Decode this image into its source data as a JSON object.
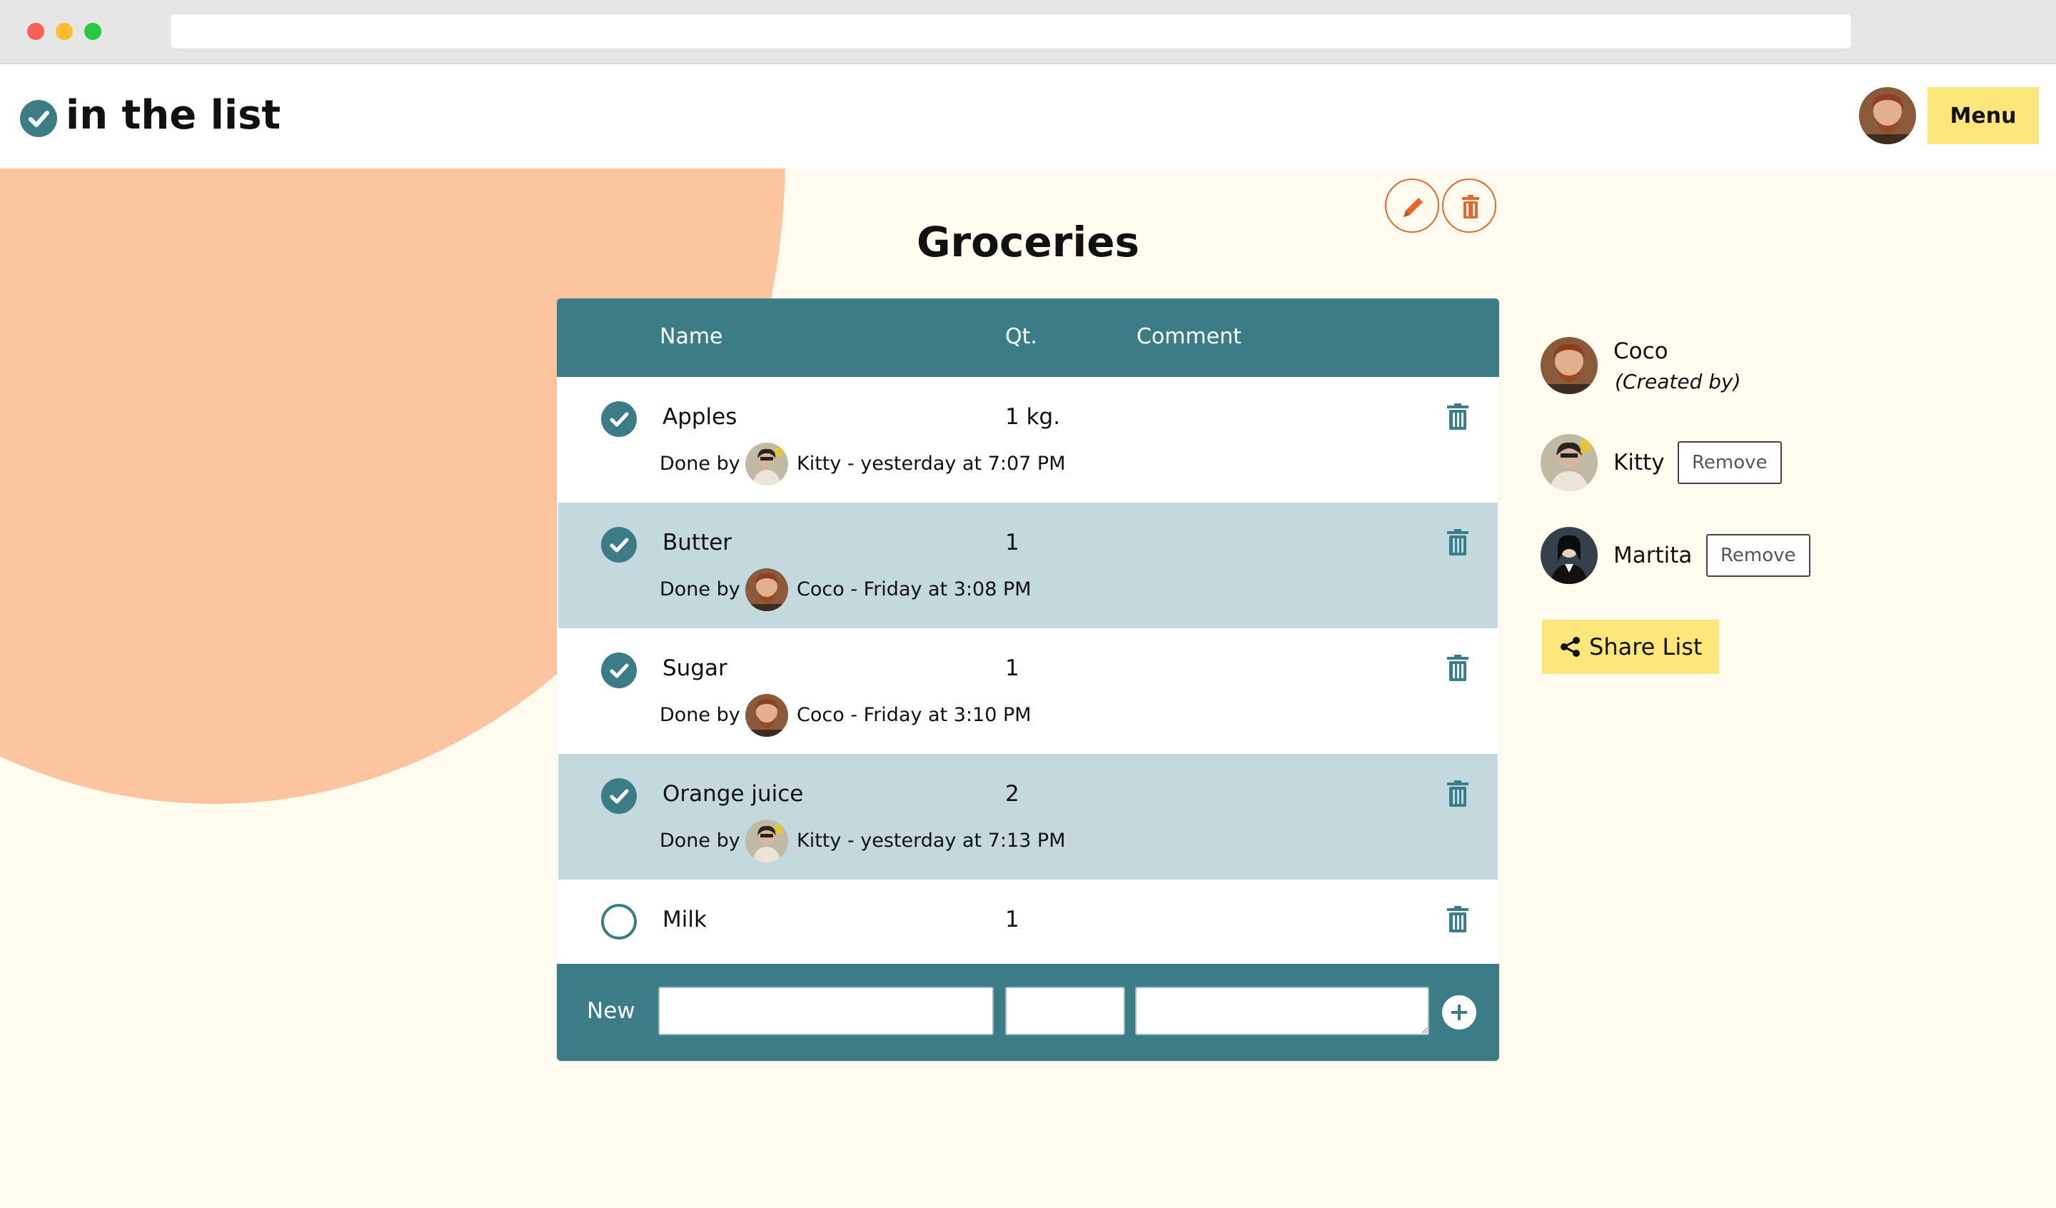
{
  "header": {
    "app_name": "in the list",
    "menu_label": "Menu"
  },
  "list": {
    "title": "Groceries",
    "columns": {
      "name": "Name",
      "qty": "Qt.",
      "comment": "Comment"
    },
    "items": [
      {
        "name": "Apples",
        "qty": "1 kg.",
        "done": true,
        "done_prefix": "Done by",
        "done_info": "Kitty - yesterday at 7:07 PM"
      },
      {
        "name": "Butter",
        "qty": "1",
        "done": true,
        "done_prefix": "Done by",
        "done_info": "Coco - Friday at 3:08 PM"
      },
      {
        "name": "Sugar",
        "qty": "1",
        "done": true,
        "done_prefix": "Done by",
        "done_info": "Coco - Friday at 3:10 PM"
      },
      {
        "name": "Orange juice",
        "qty": "2",
        "done": true,
        "done_prefix": "Done by",
        "done_info": "Kitty - yesterday at 7:13 PM"
      },
      {
        "name": "Milk",
        "qty": "1",
        "done": false
      }
    ],
    "new_row": {
      "label": "New",
      "name_value": "",
      "qty_value": "",
      "comment_value": ""
    }
  },
  "members": [
    {
      "name": "Coco",
      "role": "(Created by)"
    },
    {
      "name": "Kitty",
      "action": "Remove"
    },
    {
      "name": "Martita",
      "action": "Remove"
    }
  ],
  "share_label": "Share List",
  "colors": {
    "primary": "#3b7c86",
    "accent": "#e8662b",
    "yellow": "#fde67a",
    "peach": "#fcc49f",
    "background": "#fffbee",
    "row_alt": "#c3d9dd"
  },
  "icons": [
    "check-circle-icon",
    "pencil-icon",
    "trash-icon",
    "plus-icon",
    "share-icon"
  ]
}
